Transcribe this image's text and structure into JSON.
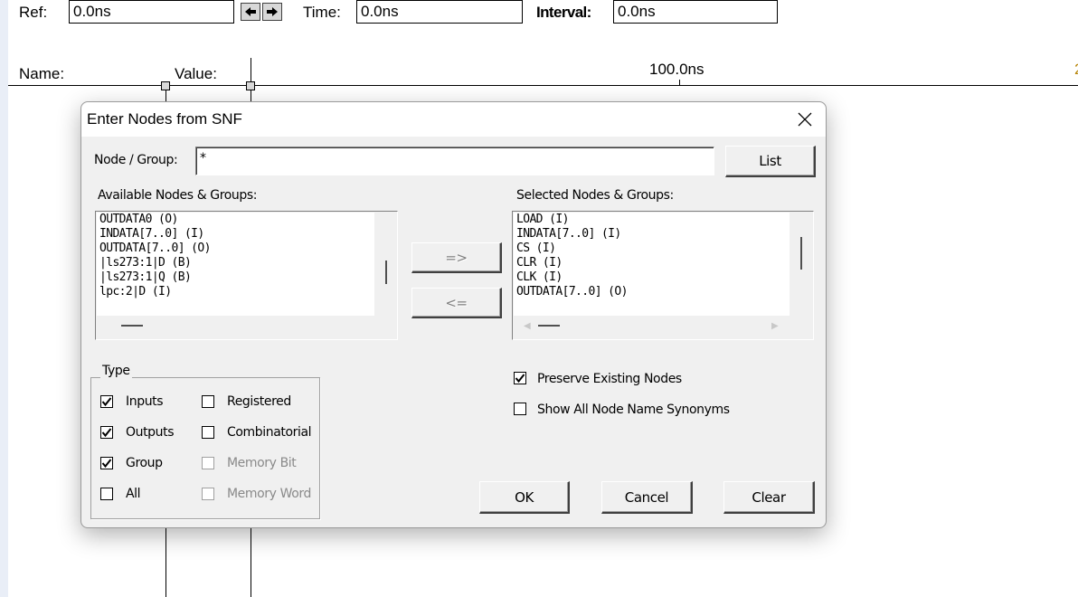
{
  "toolbar": {
    "ref_label": "Ref:",
    "ref_value": "0.0ns",
    "time_label": "Time:",
    "time_value": "0.0ns",
    "interval_label": "Interval:",
    "interval_value": "0.0ns"
  },
  "waveform": {
    "name_header": "Name:",
    "value_header": "Value:",
    "time_marker": "100.0ns"
  },
  "dialog": {
    "title": "Enter Nodes from SNF",
    "node_group_label": "Node / Group:",
    "node_group_value": "*",
    "list_button": "List",
    "available_label": "Available Nodes & Groups:",
    "available_items": [
      "OUTDATA0 (O)",
      "INDATA[7..0] (I)",
      "OUTDATA[7..0] (O)",
      "|ls273:1|D (B)",
      "|ls273:1|Q (B)",
      "lpc:2|D (I)"
    ],
    "selected_label": "Selected Nodes & Groups:",
    "selected_items": [
      "LOAD (I)",
      "INDATA[7..0] (I)",
      "CS (I)",
      "CLR (I)",
      "CLK (I)",
      "OUTDATA[7..0] (O)"
    ],
    "add_button": "=>",
    "remove_button": "<=",
    "type_group_label": "Type",
    "type_options": [
      {
        "label": "Inputs",
        "checked": true,
        "enabled": true
      },
      {
        "label": "Outputs",
        "checked": true,
        "enabled": true
      },
      {
        "label": "Group",
        "checked": true,
        "enabled": true
      },
      {
        "label": "All",
        "checked": false,
        "enabled": true
      },
      {
        "label": "Registered",
        "checked": false,
        "enabled": true
      },
      {
        "label": "Combinatorial",
        "checked": false,
        "enabled": true
      },
      {
        "label": "Memory Bit",
        "checked": false,
        "enabled": false
      },
      {
        "label": "Memory Word",
        "checked": false,
        "enabled": false
      }
    ],
    "preserve_label": "Preserve Existing Nodes",
    "preserve_checked": true,
    "synonyms_label": "Show All Node Name Synonyms",
    "synonyms_checked": false,
    "ok_button": "OK",
    "cancel_button": "Cancel",
    "clear_button": "Clear"
  }
}
